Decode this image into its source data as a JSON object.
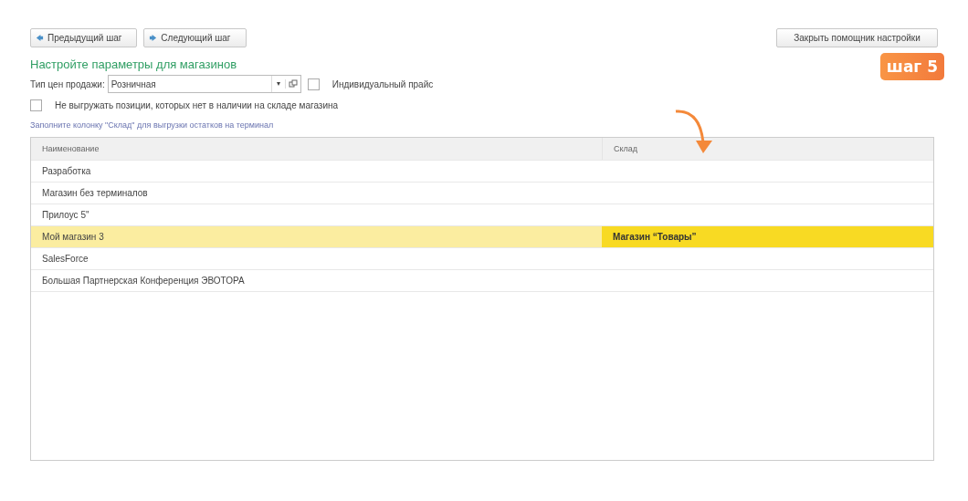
{
  "toolbar": {
    "prev_button": "Предыдущий шаг",
    "next_button": "Следующий шаг",
    "close_button": "Закрыть помощник настройки"
  },
  "step_badge": "шаг 5",
  "heading": "Настройте параметры для магазинов",
  "price_type": {
    "label": "Тип цен продажи:",
    "value": "Розничная",
    "dropdown_glyph": "▾"
  },
  "individual_price": {
    "label": "Индивидуальный прайс",
    "checked": false
  },
  "skip_missing": {
    "label": "Не выгружать позиции, которых нет в наличии на складе магазина",
    "checked": false
  },
  "hint": "Заполните колонку \"Склад\" для выгрузки остатков на терминал",
  "table": {
    "columns": [
      "Наименование",
      "Склад"
    ],
    "rows": [
      {
        "name": "Разработка",
        "selected": false
      },
      {
        "name": "Магазин без терминалов",
        "selected": false
      },
      {
        "name": "Прилоус 5\"",
        "selected": false
      },
      {
        "name": "Мой магазин 3",
        "warehouse": "Магазин “Товары”",
        "selected": true
      },
      {
        "name": "SalesForce",
        "selected": false
      },
      {
        "name": "Большая Партнерская Конференция ЭВОТОРА",
        "selected": false
      }
    ]
  }
}
